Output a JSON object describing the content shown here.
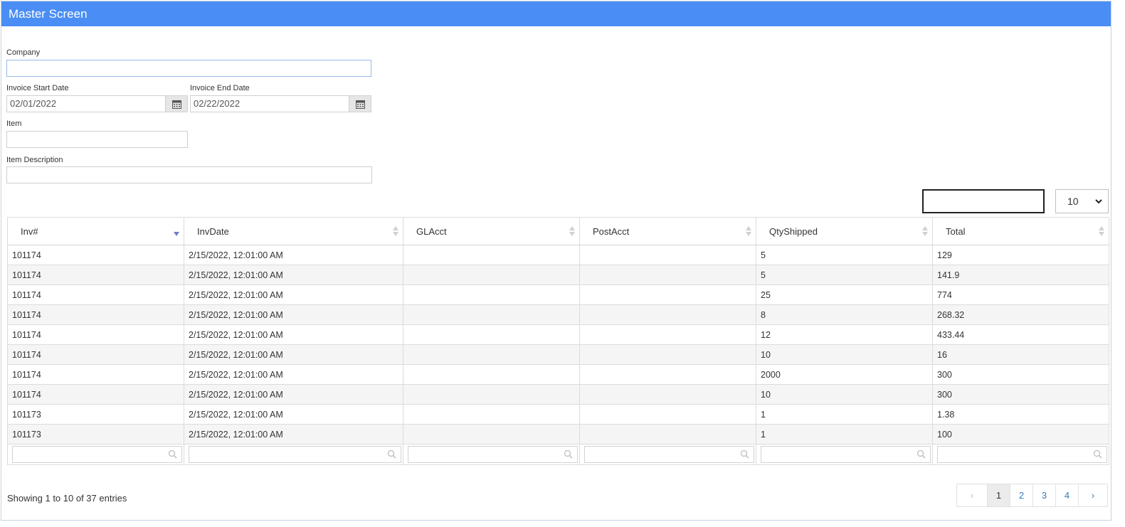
{
  "window": {
    "title": "Master Screen"
  },
  "filters": {
    "company": {
      "label": "Company",
      "value": ""
    },
    "invoice_start": {
      "label": "Invoice Start Date",
      "value": "02/01/2022"
    },
    "invoice_end": {
      "label": "Invoice End Date",
      "value": "02/22/2022"
    },
    "item": {
      "label": "Item",
      "value": ""
    },
    "item_description": {
      "label": "Item Description",
      "value": ""
    }
  },
  "toolbar": {
    "search_value": "",
    "page_length": "10"
  },
  "grid": {
    "columns": [
      "Inv#",
      "InvDate",
      "GLAcct",
      "PostAcct",
      "QtyShipped",
      "Total"
    ],
    "rows": [
      [
        "101174",
        "2/15/2022, 12:01:00 AM",
        "",
        "",
        "5",
        "129"
      ],
      [
        "101174",
        "2/15/2022, 12:01:00 AM",
        "",
        "",
        "5",
        "141.9"
      ],
      [
        "101174",
        "2/15/2022, 12:01:00 AM",
        "",
        "",
        "25",
        "774"
      ],
      [
        "101174",
        "2/15/2022, 12:01:00 AM",
        "",
        "",
        "8",
        "268.32"
      ],
      [
        "101174",
        "2/15/2022, 12:01:00 AM",
        "",
        "",
        "12",
        "433.44"
      ],
      [
        "101174",
        "2/15/2022, 12:01:00 AM",
        "",
        "",
        "10",
        "16"
      ],
      [
        "101174",
        "2/15/2022, 12:01:00 AM",
        "",
        "",
        "2000",
        "300"
      ],
      [
        "101174",
        "2/15/2022, 12:01:00 AM",
        "",
        "",
        "10",
        "300"
      ],
      [
        "101173",
        "2/15/2022, 12:01:00 AM",
        "",
        "",
        "1",
        "1.38"
      ],
      [
        "101173",
        "2/15/2022, 12:01:00 AM",
        "",
        "",
        "1",
        "100"
      ]
    ]
  },
  "footer": {
    "info": "Showing 1 to 10 of 37 entries",
    "pages": [
      "1",
      "2",
      "3",
      "4"
    ],
    "prev": "‹",
    "next": "›"
  },
  "colors": {
    "titlebar": "#4a8ef5",
    "link": "#337ab7",
    "sort_active": "#6b7fc4"
  },
  "icons": {
    "calendar": "calendar-icon",
    "search": "search-icon",
    "sort": "sort-arrows-icon"
  }
}
